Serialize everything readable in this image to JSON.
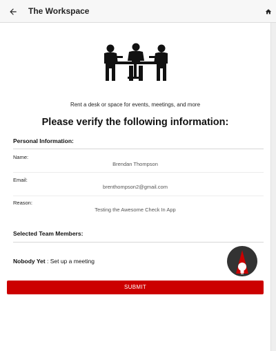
{
  "appbar": {
    "title": "The Workspace",
    "back_icon": "arrow-left-icon",
    "home_icon": "home-icon"
  },
  "hero": {
    "icon": "meeting-people-icon",
    "subtitle": "Rent a desk or space for events, meetings, and more"
  },
  "heading": "Please verify the following information:",
  "personal": {
    "section_title": "Personal Information:",
    "fields": [
      {
        "label": "Name:",
        "value": "Brendan Thompson"
      },
      {
        "label": "Email:",
        "value": "brenthompson2@gmail.com"
      },
      {
        "label": "Reason:",
        "value": "Testing the Awesome Check In App"
      }
    ]
  },
  "team": {
    "section_title": "Selected Team Members:",
    "empty_bold": "Nobody Yet",
    "empty_rest": " : Set up a meeting",
    "fab_icon": "lightbulb-icon"
  },
  "submit_label": "SUBMIT",
  "colors": {
    "accent": "#cc0000",
    "fab_dark": "#333333"
  }
}
